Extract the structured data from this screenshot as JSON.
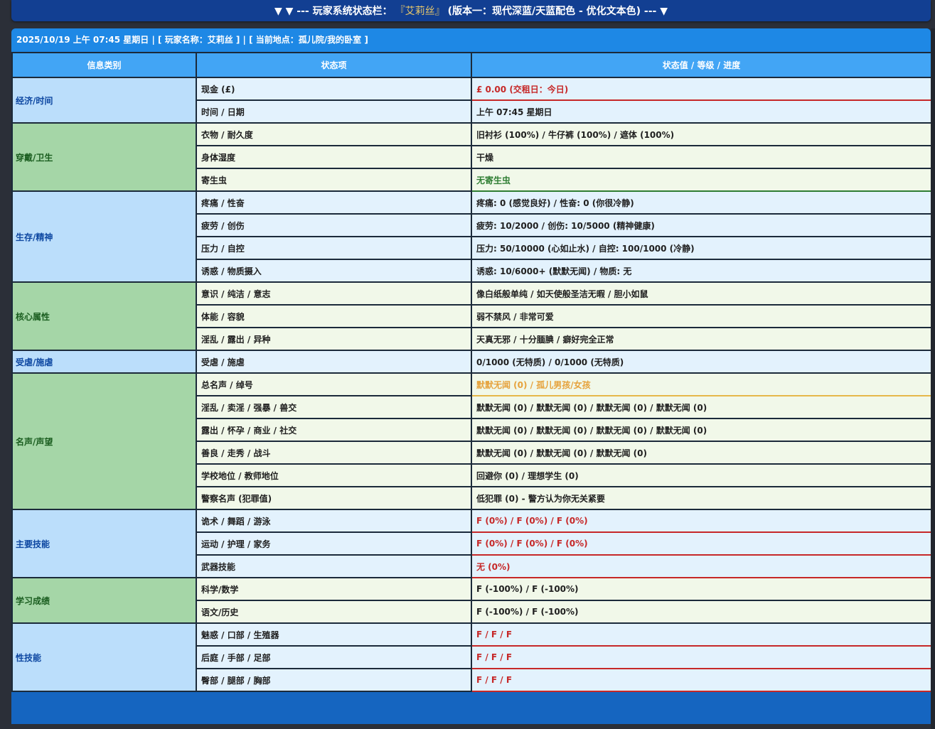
{
  "summary": {
    "prefix": "▼ ▼ --- 玩家系统状态栏：",
    "name": "『艾莉丝』",
    "suffix": "(版本一：现代深蓝/天蓝配色 - 优化文本色) --- ▼"
  },
  "info_bar": "2025/10/19 上午 07:45 星期日 | [ 玩家名称：艾莉丝 ] | [ 当前地点：孤儿院/我的卧室 ]",
  "table": {
    "headers": [
      "信息类别",
      "状态项",
      "状态值 / 等级 / 进度"
    ],
    "groups": [
      {
        "category": "经济/时间",
        "tone": "blue",
        "rows": [
          {
            "item": "现金 (£)",
            "value": "£ 0.00 (交租日：今日)",
            "style": "red"
          },
          {
            "item": "时间 / 日期",
            "value": "上午 07:45 星期日",
            "style": ""
          }
        ]
      },
      {
        "category": "穿戴/卫生",
        "tone": "green",
        "rows": [
          {
            "item": "衣物 / 耐久度",
            "value": "旧衬衫 (100%) / 牛仔裤 (100%) / 遮体 (100%)",
            "style": ""
          },
          {
            "item": "身体湿度",
            "value": "干燥",
            "style": ""
          },
          {
            "item": "寄生虫",
            "value": "无寄生虫",
            "style": "green"
          }
        ]
      },
      {
        "category": "生存/精神",
        "tone": "blue",
        "rows": [
          {
            "item": "疼痛 / 性奋",
            "value": "疼痛: 0 (感觉良好) / 性奋: 0 (你很冷静)",
            "style": ""
          },
          {
            "item": "疲劳 / 创伤",
            "value": "疲劳: 10/2000 / 创伤: 10/5000 (精神健康)",
            "style": ""
          },
          {
            "item": "压力 / 自控",
            "value": "压力: 50/10000 (心如止水) / 自控: 100/1000 (冷静)",
            "style": ""
          },
          {
            "item": "诱惑 / 物质摄入",
            "value": "诱惑: 10/6000+ (默默无闻) / 物质: 无",
            "style": ""
          }
        ]
      },
      {
        "category": "核心属性",
        "tone": "green",
        "rows": [
          {
            "item": "意识 / 纯洁 / 意志",
            "value": "像白纸般单纯 / 如天使般圣洁无暇 / 胆小如鼠",
            "style": ""
          },
          {
            "item": "体能 / 容貌",
            "value": "弱不禁风 / 非常可爱",
            "style": ""
          },
          {
            "item": "淫乱 / 露出 / 异种",
            "value": "天真无邪 / 十分腼腆 / 癖好完全正常",
            "style": ""
          }
        ]
      },
      {
        "category": "受虐/施虐",
        "tone": "blue",
        "rows": [
          {
            "item": "受虐 / 施虐",
            "value": "0/1000 (无特质) / 0/1000 (无特质)",
            "style": ""
          }
        ]
      },
      {
        "category": "名声/声望",
        "tone": "green",
        "rows": [
          {
            "item": "总名声 / 绰号",
            "value": "默默无闻 (0) / 孤儿男孩/女孩",
            "style": "gold"
          },
          {
            "item": "淫乱 / 卖淫 / 强暴 / 兽交",
            "value": "默默无闻 (0) / 默默无闻 (0) / 默默无闻 (0) / 默默无闻 (0)",
            "style": ""
          },
          {
            "item": "露出 / 怀孕 / 商业 / 社交",
            "value": "默默无闻 (0) / 默默无闻 (0) / 默默无闻 (0) / 默默无闻 (0)",
            "style": ""
          },
          {
            "item": "善良 / 走秀 / 战斗",
            "value": "默默无闻 (0) / 默默无闻 (0) / 默默无闻 (0)",
            "style": ""
          },
          {
            "item": "学校地位 / 教师地位",
            "value": "回避你 (0) / 理想学生 (0)",
            "style": ""
          },
          {
            "item": "警察名声 (犯罪值)",
            "value": "低犯罪 (0) - 警方认为你无关紧要",
            "style": ""
          }
        ]
      },
      {
        "category": "主要技能",
        "tone": "blue",
        "rows": [
          {
            "item": "诡术 / 舞蹈 / 游泳",
            "value": "F (0%) / F (0%) / F (0%)",
            "style": "red"
          },
          {
            "item": "运动 / 护理 / 家务",
            "value": "F (0%) / F (0%) / F (0%)",
            "style": "red"
          },
          {
            "item": "武器技能",
            "value": "无 (0%)",
            "style": "red"
          }
        ]
      },
      {
        "category": "学习成绩",
        "tone": "green",
        "rows": [
          {
            "item": "科学/数学",
            "value": "F (-100%) / F (-100%)",
            "style": ""
          },
          {
            "item": "语文/历史",
            "value": "F (-100%) / F (-100%)",
            "style": ""
          }
        ]
      },
      {
        "category": "性技能",
        "tone": "blue",
        "rows": [
          {
            "item": "魅惑 / 口部 / 生殖器",
            "value": "F / F / F",
            "style": "red"
          },
          {
            "item": "后庭 / 手部 / 足部",
            "value": "F / F / F",
            "style": "red"
          },
          {
            "item": "臀部 / 腿部 / 胸部",
            "value": "F / F / F",
            "style": "red"
          }
        ]
      }
    ]
  },
  "colors": {
    "header_bar": "#123f92",
    "panel": "#1565c0",
    "column_header": "#42a5f5",
    "category_blue": "#bbdefb",
    "category_green": "#a5d6a7",
    "value_red": "#c62828",
    "value_green": "#2e7d32",
    "value_gold": "#e6a23c"
  }
}
